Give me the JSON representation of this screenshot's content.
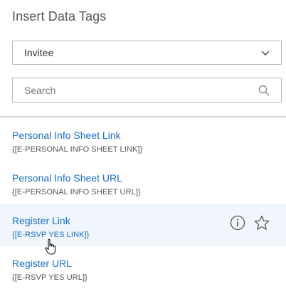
{
  "panel": {
    "title": "Insert Data Tags",
    "dropdown": {
      "selected": "Invitee"
    },
    "search": {
      "placeholder": "Search"
    }
  },
  "items": [
    {
      "name": "Personal Info Sheet Link",
      "tag": "{[E-PERSONAL INFO SHEET LINK]}"
    },
    {
      "name": "Personal Info Sheet URL",
      "tag": "{[E-PERSONAL INFO SHEET URL]}"
    },
    {
      "name": "Register Link",
      "tag": "{[E-RSVP YES LINK]}"
    },
    {
      "name": "Register URL",
      "tag": "{[E-RSVP YES URL]}"
    }
  ],
  "colors": {
    "link": "#1a6fc2",
    "hover_row": "#f0f6fb",
    "border": "#b9b9b9"
  }
}
